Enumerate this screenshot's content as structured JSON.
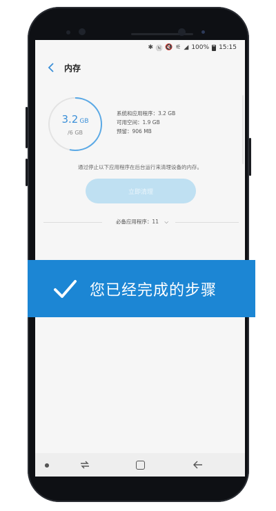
{
  "status_bar": {
    "battery": "100%",
    "time": "15:15"
  },
  "header": {
    "title": "内存"
  },
  "storage": {
    "used_value": "3.2",
    "used_unit": "GB",
    "total": "/6 GB",
    "used_fraction": 0.533,
    "system_apps": "系统和应用程序：3.2 GB",
    "available": "可用空间：1.9 GB",
    "reserved": "预留：906 MB"
  },
  "hint": "通过停止以下应用程序在后台运行来清理设备的内存。",
  "clean_button_label": "立即清理",
  "essential_apps": "必备应用程序：11",
  "banner": {
    "text": "您已经完成的步骤"
  },
  "colors": {
    "accent": "#3a8fd8",
    "banner": "#1c86d4",
    "button_disabled": "#bfe0f2"
  }
}
